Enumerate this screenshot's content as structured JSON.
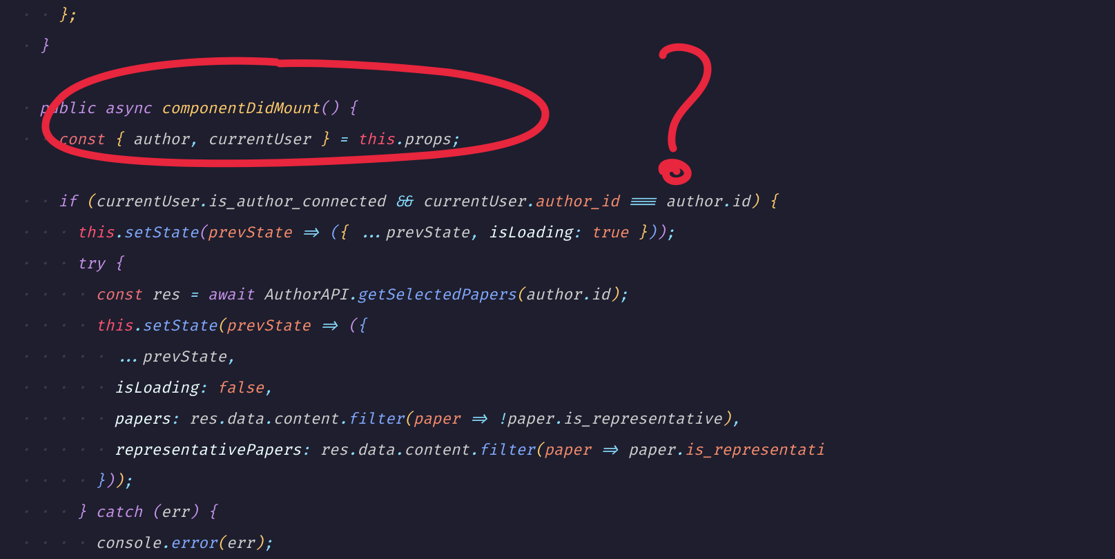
{
  "code": {
    "line1": {
      "punct1": "};",
      "ws": "    "
    },
    "line2": {
      "punct1": "}",
      "ws": "  "
    },
    "line3": {
      "ws": ""
    },
    "line4": {
      "ws": "  ",
      "kw1": "public",
      "kw2": "async",
      "fn": "componentDidMount",
      "paren": "()",
      "brace": "{"
    },
    "line5": {
      "ws": "    ",
      "kw": "const",
      "brace1": "{",
      "var1": "author",
      "comma": ",",
      "var2": "currentUser",
      "brace2": "}",
      "eq": "=",
      "this": "this",
      "dot": ".",
      "prop": "props",
      "semi": ";"
    },
    "line6": {
      "ws": ""
    },
    "line7": {
      "ws": "    ",
      "kw": "if",
      "paren1": "(",
      "var1": "currentUser",
      "dot1": ".",
      "prop1": "is_author_connected",
      "op1": "&&",
      "var2": "currentUser",
      "dot2": ".",
      "prop2": "author_id",
      "op2": "===",
      "var3": "author",
      "dot3": ".",
      "prop3": "id",
      "paren2": ")",
      "brace": "{"
    },
    "line8": {
      "ws": "      ",
      "this": "this",
      "dot1": ".",
      "method": "setState",
      "paren1": "(",
      "param": "prevState",
      "arrow": "=>",
      "paren2": "(",
      "brace1": "{",
      "spread": "...",
      "var": "prevState",
      "comma": ",",
      "prop": "isLoading",
      "colon": ":",
      "bool": "true",
      "brace2": "}",
      "paren3": ")",
      "paren4": ")",
      "semi": ";"
    },
    "line9": {
      "ws": "      ",
      "kw": "try",
      "brace": "{"
    },
    "line10": {
      "ws": "        ",
      "kw1": "const",
      "var": "res",
      "eq": "=",
      "kw2": "await",
      "obj": "AuthorAPI",
      "dot": ".",
      "method": "getSelectedPapers",
      "paren1": "(",
      "arg1": "author",
      "dot2": ".",
      "arg2": "id",
      "paren2": ")",
      "semi": ";"
    },
    "line11": {
      "ws": "        ",
      "this": "this",
      "dot": ".",
      "method": "setState",
      "paren1": "(",
      "param": "prevState",
      "arrow": "=>",
      "paren2": "(",
      "brace": "{"
    },
    "line12": {
      "ws": "          ",
      "spread": "...",
      "var": "prevState",
      "comma": ","
    },
    "line13": {
      "ws": "          ",
      "prop": "isLoading",
      "colon": ":",
      "bool": "false",
      "comma": ","
    },
    "line14": {
      "ws": "          ",
      "prop": "papers",
      "colon": ":",
      "var1": "res",
      "dot1": ".",
      "prop2": "data",
      "dot2": ".",
      "prop3": "content",
      "dot3": ".",
      "method": "filter",
      "paren1": "(",
      "param": "paper",
      "arrow": "=>",
      "not": "!",
      "var2": "paper",
      "dot4": ".",
      "prop4": "is_representative",
      "paren2": ")",
      "comma": ","
    },
    "line15": {
      "ws": "          ",
      "prop": "representativePapers",
      "colon": ":",
      "var1": "res",
      "dot1": ".",
      "prop2": "data",
      "dot2": ".",
      "prop3": "content",
      "dot3": ".",
      "method": "filter",
      "paren1": "(",
      "param": "paper",
      "arrow": "=>",
      "var2": "paper",
      "dot4": ".",
      "prop4": "is_representati"
    },
    "line16": {
      "ws": "        ",
      "brace": "}",
      "paren1": ")",
      "paren2": ")",
      "semi": ";"
    },
    "line17": {
      "ws": "      ",
      "brace1": "}",
      "kw": "catch",
      "paren1": "(",
      "var": "err",
      "paren2": ")",
      "brace2": "{"
    },
    "line18": {
      "ws": "        ",
      "obj": "console",
      "dot": ".",
      "method": "error",
      "paren1": "(",
      "var": "err",
      "paren2": ")",
      "semi": ";"
    }
  },
  "annotation_color": "#e8263d"
}
